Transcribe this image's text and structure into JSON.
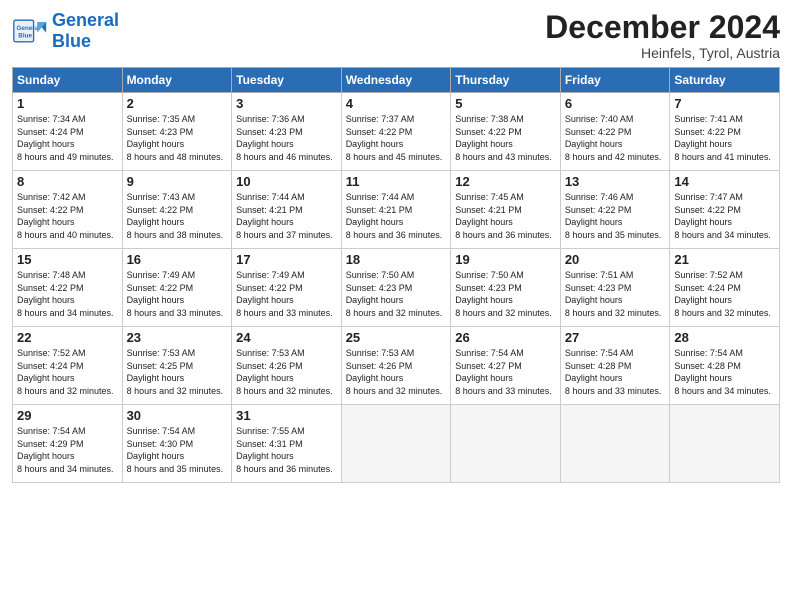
{
  "header": {
    "logo_general": "General",
    "logo_blue": "Blue",
    "month": "December 2024",
    "location": "Heinfels, Tyrol, Austria"
  },
  "weekdays": [
    "Sunday",
    "Monday",
    "Tuesday",
    "Wednesday",
    "Thursday",
    "Friday",
    "Saturday"
  ],
  "weeks": [
    [
      {
        "day": "1",
        "sunrise": "7:34 AM",
        "sunset": "4:24 PM",
        "daylight": "8 hours and 49 minutes."
      },
      {
        "day": "2",
        "sunrise": "7:35 AM",
        "sunset": "4:23 PM",
        "daylight": "8 hours and 48 minutes."
      },
      {
        "day": "3",
        "sunrise": "7:36 AM",
        "sunset": "4:23 PM",
        "daylight": "8 hours and 46 minutes."
      },
      {
        "day": "4",
        "sunrise": "7:37 AM",
        "sunset": "4:22 PM",
        "daylight": "8 hours and 45 minutes."
      },
      {
        "day": "5",
        "sunrise": "7:38 AM",
        "sunset": "4:22 PM",
        "daylight": "8 hours and 43 minutes."
      },
      {
        "day": "6",
        "sunrise": "7:40 AM",
        "sunset": "4:22 PM",
        "daylight": "8 hours and 42 minutes."
      },
      {
        "day": "7",
        "sunrise": "7:41 AM",
        "sunset": "4:22 PM",
        "daylight": "8 hours and 41 minutes."
      }
    ],
    [
      {
        "day": "8",
        "sunrise": "7:42 AM",
        "sunset": "4:22 PM",
        "daylight": "8 hours and 40 minutes."
      },
      {
        "day": "9",
        "sunrise": "7:43 AM",
        "sunset": "4:22 PM",
        "daylight": "8 hours and 38 minutes."
      },
      {
        "day": "10",
        "sunrise": "7:44 AM",
        "sunset": "4:21 PM",
        "daylight": "8 hours and 37 minutes."
      },
      {
        "day": "11",
        "sunrise": "7:44 AM",
        "sunset": "4:21 PM",
        "daylight": "8 hours and 36 minutes."
      },
      {
        "day": "12",
        "sunrise": "7:45 AM",
        "sunset": "4:21 PM",
        "daylight": "8 hours and 36 minutes."
      },
      {
        "day": "13",
        "sunrise": "7:46 AM",
        "sunset": "4:22 PM",
        "daylight": "8 hours and 35 minutes."
      },
      {
        "day": "14",
        "sunrise": "7:47 AM",
        "sunset": "4:22 PM",
        "daylight": "8 hours and 34 minutes."
      }
    ],
    [
      {
        "day": "15",
        "sunrise": "7:48 AM",
        "sunset": "4:22 PM",
        "daylight": "8 hours and 34 minutes."
      },
      {
        "day": "16",
        "sunrise": "7:49 AM",
        "sunset": "4:22 PM",
        "daylight": "8 hours and 33 minutes."
      },
      {
        "day": "17",
        "sunrise": "7:49 AM",
        "sunset": "4:22 PM",
        "daylight": "8 hours and 33 minutes."
      },
      {
        "day": "18",
        "sunrise": "7:50 AM",
        "sunset": "4:23 PM",
        "daylight": "8 hours and 32 minutes."
      },
      {
        "day": "19",
        "sunrise": "7:50 AM",
        "sunset": "4:23 PM",
        "daylight": "8 hours and 32 minutes."
      },
      {
        "day": "20",
        "sunrise": "7:51 AM",
        "sunset": "4:23 PM",
        "daylight": "8 hours and 32 minutes."
      },
      {
        "day": "21",
        "sunrise": "7:52 AM",
        "sunset": "4:24 PM",
        "daylight": "8 hours and 32 minutes."
      }
    ],
    [
      {
        "day": "22",
        "sunrise": "7:52 AM",
        "sunset": "4:24 PM",
        "daylight": "8 hours and 32 minutes."
      },
      {
        "day": "23",
        "sunrise": "7:53 AM",
        "sunset": "4:25 PM",
        "daylight": "8 hours and 32 minutes."
      },
      {
        "day": "24",
        "sunrise": "7:53 AM",
        "sunset": "4:26 PM",
        "daylight": "8 hours and 32 minutes."
      },
      {
        "day": "25",
        "sunrise": "7:53 AM",
        "sunset": "4:26 PM",
        "daylight": "8 hours and 32 minutes."
      },
      {
        "day": "26",
        "sunrise": "7:54 AM",
        "sunset": "4:27 PM",
        "daylight": "8 hours and 33 minutes."
      },
      {
        "day": "27",
        "sunrise": "7:54 AM",
        "sunset": "4:28 PM",
        "daylight": "8 hours and 33 minutes."
      },
      {
        "day": "28",
        "sunrise": "7:54 AM",
        "sunset": "4:28 PM",
        "daylight": "8 hours and 34 minutes."
      }
    ],
    [
      {
        "day": "29",
        "sunrise": "7:54 AM",
        "sunset": "4:29 PM",
        "daylight": "8 hours and 34 minutes."
      },
      {
        "day": "30",
        "sunrise": "7:54 AM",
        "sunset": "4:30 PM",
        "daylight": "8 hours and 35 minutes."
      },
      {
        "day": "31",
        "sunrise": "7:55 AM",
        "sunset": "4:31 PM",
        "daylight": "8 hours and 36 minutes."
      },
      null,
      null,
      null,
      null
    ]
  ]
}
